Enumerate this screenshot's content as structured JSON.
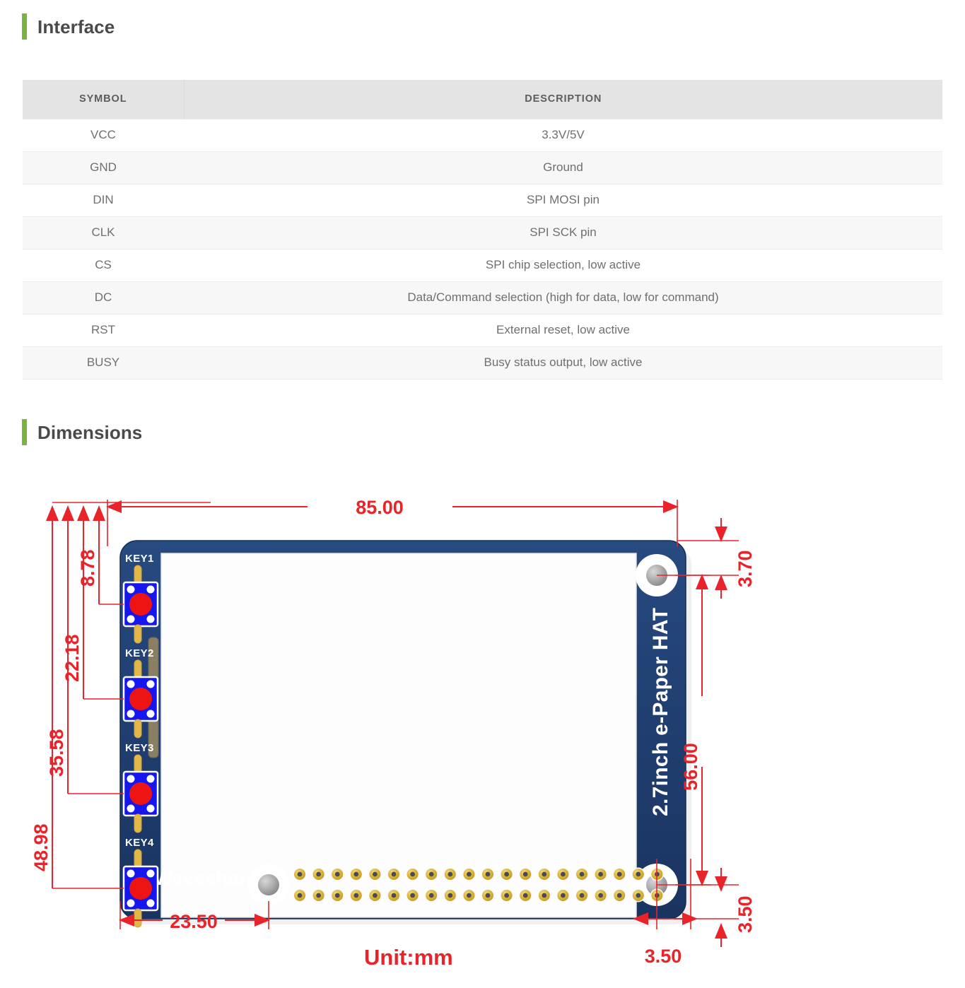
{
  "sections": {
    "interface": {
      "title": "Interface"
    },
    "dimensions": {
      "title": "Dimensions"
    }
  },
  "interface_table": {
    "headers": {
      "symbol": "SYMBOL",
      "description": "DESCRIPTION"
    },
    "rows": [
      {
        "symbol": "VCC",
        "description": "3.3V/5V"
      },
      {
        "symbol": "GND",
        "description": "Ground"
      },
      {
        "symbol": "DIN",
        "description": "SPI MOSI pin"
      },
      {
        "symbol": "CLK",
        "description": "SPI SCK pin"
      },
      {
        "symbol": "CS",
        "description": "SPI chip selection, low active"
      },
      {
        "symbol": "DC",
        "description": "Data/Command selection (high for data, low for command)"
      },
      {
        "symbol": "RST",
        "description": "External reset, low active"
      },
      {
        "symbol": "BUSY",
        "description": "Busy status output, low active"
      }
    ]
  },
  "dimension_drawing": {
    "unit_label": "Unit:mm",
    "board_silkscreen": {
      "model": "2.7inch e-Paper HAT",
      "brand": "Waveshare",
      "keys": [
        "KEY1",
        "KEY2",
        "KEY3",
        "KEY4"
      ]
    },
    "measurements": {
      "width_top": "85.00",
      "height_right": "56.00",
      "hole_offset_top_right": "3.70",
      "hole_offset_bottom_right_v": "3.50",
      "hole_offset_bottom_right_h": "3.50",
      "hole_offset_bottom_left": "23.50",
      "key1": "8.78",
      "key2": "22.18",
      "key3": "35.58",
      "key4": "48.98"
    }
  },
  "colors": {
    "accent_green": "#7ab33e",
    "dimension_red": "#e8242a",
    "pcb_blue": "#1f3d6e",
    "pad_gold": "#e0b93b",
    "header_gray": "#e4e4e4"
  }
}
